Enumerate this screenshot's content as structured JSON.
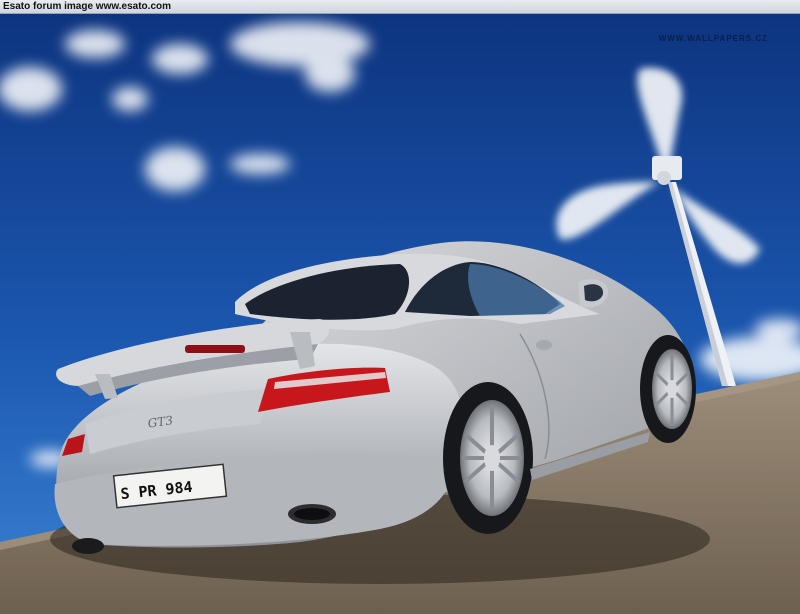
{
  "header": {
    "text": "Esato forum image www.esato.com"
  },
  "watermark": {
    "text": "WWW.WALLPAPERS.CZ"
  },
  "car": {
    "badge": "GT3",
    "license_plate": "S PR 984"
  },
  "colors": {
    "sky_top": "#0f3a8c",
    "sky_bottom": "#2e74c9",
    "car_silver": "#c3c6cb",
    "taillight": "#c8161d",
    "road": "#8a7a68"
  }
}
